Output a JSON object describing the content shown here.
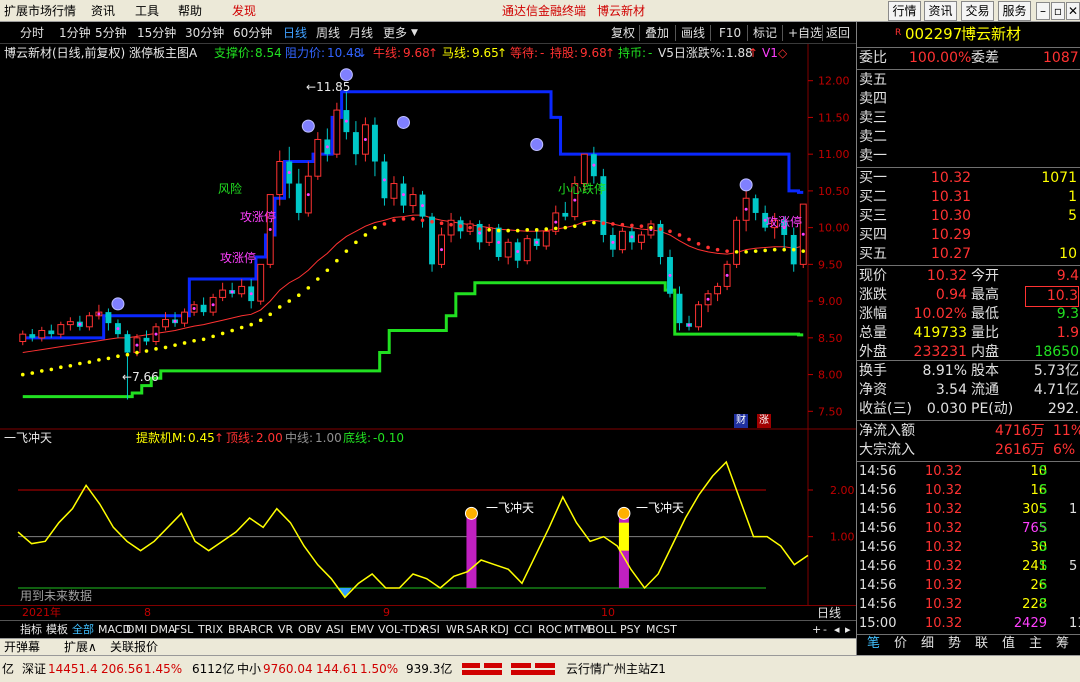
{
  "menu": {
    "items": [
      "扩展市场行情",
      "资讯",
      "工具",
      "帮助"
    ],
    "discover": "发现",
    "center_title": "通达信金融终端",
    "center_stock": "博云新材",
    "right_buttons": [
      "行情",
      "资讯",
      "交易",
      "服务"
    ],
    "win_controls": [
      "–",
      "▫",
      "✕"
    ]
  },
  "periods": {
    "items": [
      "分时",
      "1分钟",
      "5分钟",
      "15分钟",
      "30分钟",
      "60分钟",
      "日线",
      "周线",
      "月线",
      "更多"
    ],
    "active": "日线",
    "more_arrow": "▼",
    "right_items": [
      "复权",
      "叠加",
      "画线",
      "F10",
      "标记",
      "+自选",
      "返回"
    ]
  },
  "info_line": {
    "title": "博云新材(日线,前复权) 涨停板主图A",
    "support_label": "支撑价:",
    "support_value": "8.54",
    "resist_label": "阻力价:",
    "resist_value": "10.48",
    "resist_arrow": "↓",
    "bull_label": "牛线:",
    "bull_value": "9.68",
    "bull_arrow": "↑",
    "horse_label": "马线:",
    "horse_value": "9.65",
    "horse_arrow": "↑",
    "wait_label": "等待:",
    "wait_value": "-",
    "hold_label": "持股:",
    "hold_value": "9.68",
    "hold_arrow": "↑",
    "coin_label": "持币:",
    "coin_value": "-",
    "v5_label": "V5日涨跌%:",
    "v5_value": "1.88",
    "v5_arrow": "↑",
    "v1": "V1",
    "diamond": "◇"
  },
  "main_chart": {
    "y_ticks": [
      "12.00",
      "11.50",
      "11.00",
      "10.50",
      "10.00",
      "9.50",
      "9.00",
      "8.50",
      "8.00",
      "7.50"
    ],
    "high_label": "11.85",
    "low_label": "7.66",
    "annotations": [
      "风险",
      "攻涨停",
      "攻涨停",
      "小心跌停",
      "攻涨停"
    ],
    "badges": [
      "财",
      "涨"
    ]
  },
  "chart_data": {
    "type": "candlestick",
    "y_range": [
      7.3,
      12.2
    ],
    "candles": [
      [
        8.45,
        8.55,
        8.6,
        8.4
      ],
      [
        8.55,
        8.5,
        8.62,
        8.45
      ],
      [
        8.5,
        8.6,
        8.65,
        8.45
      ],
      [
        8.6,
        8.55,
        8.68,
        8.5
      ],
      [
        8.55,
        8.68,
        8.72,
        8.5
      ],
      [
        8.68,
        8.72,
        8.78,
        8.6
      ],
      [
        8.72,
        8.65,
        8.8,
        8.6
      ],
      [
        8.65,
        8.8,
        8.85,
        8.6
      ],
      [
        8.8,
        8.85,
        8.95,
        8.75
      ],
      [
        8.85,
        8.7,
        8.9,
        8.6
      ],
      [
        8.7,
        8.55,
        8.75,
        8.5
      ],
      [
        8.55,
        8.3,
        8.6,
        7.66
      ],
      [
        8.3,
        8.5,
        8.55,
        8.25
      ],
      [
        8.5,
        8.45,
        8.6,
        8.4
      ],
      [
        8.45,
        8.65,
        8.7,
        8.4
      ],
      [
        8.65,
        8.75,
        8.85,
        8.6
      ],
      [
        8.75,
        8.7,
        8.85,
        8.65
      ],
      [
        8.7,
        8.85,
        8.9,
        8.65
      ],
      [
        8.85,
        8.95,
        9.0,
        8.8
      ],
      [
        8.95,
        8.85,
        9.05,
        8.8
      ],
      [
        8.85,
        9.05,
        9.1,
        8.8
      ],
      [
        9.05,
        9.15,
        9.25,
        9.0
      ],
      [
        9.15,
        9.1,
        9.25,
        9.05
      ],
      [
        9.1,
        9.2,
        9.3,
        9.05
      ],
      [
        9.2,
        9.0,
        9.3,
        8.9
      ],
      [
        9.0,
        9.5,
        9.5,
        8.95
      ],
      [
        9.5,
        10.45,
        10.45,
        9.45
      ],
      [
        10.45,
        10.9,
        11.05,
        10.3
      ],
      [
        10.9,
        10.6,
        11.1,
        10.4
      ],
      [
        10.6,
        10.2,
        10.8,
        10.1
      ],
      [
        10.2,
        10.7,
        10.9,
        10.15
      ],
      [
        10.7,
        11.2,
        11.3,
        10.65
      ],
      [
        11.2,
        11.0,
        11.35,
        10.9
      ],
      [
        11.0,
        11.6,
        11.7,
        10.95
      ],
      [
        11.6,
        11.3,
        11.85,
        11.2
      ],
      [
        11.3,
        11.0,
        11.45,
        10.85
      ],
      [
        11.0,
        11.4,
        11.5,
        10.9
      ],
      [
        11.4,
        10.9,
        11.5,
        10.7
      ],
      [
        10.9,
        10.4,
        11.0,
        10.3
      ],
      [
        10.4,
        10.6,
        10.7,
        10.3
      ],
      [
        10.6,
        10.3,
        10.7,
        10.2
      ],
      [
        10.3,
        10.45,
        10.55,
        10.2
      ],
      [
        10.45,
        10.15,
        10.5,
        10.0
      ],
      [
        10.15,
        9.5,
        10.2,
        9.4
      ],
      [
        9.5,
        9.9,
        10.0,
        9.45
      ],
      [
        9.9,
        10.1,
        10.2,
        9.8
      ],
      [
        10.1,
        9.95,
        10.15,
        9.85
      ],
      [
        9.95,
        10.05,
        10.1,
        9.9
      ],
      [
        10.05,
        9.8,
        10.1,
        9.7
      ],
      [
        9.8,
        10.0,
        10.05,
        9.75
      ],
      [
        10.0,
        9.6,
        10.05,
        9.55
      ],
      [
        9.6,
        9.8,
        9.85,
        9.5
      ],
      [
        9.8,
        9.55,
        9.85,
        9.45
      ],
      [
        9.55,
        9.85,
        9.9,
        9.5
      ],
      [
        9.85,
        9.75,
        9.95,
        9.7
      ],
      [
        9.75,
        9.95,
        10.0,
        9.7
      ],
      [
        9.95,
        10.2,
        10.3,
        9.9
      ],
      [
        10.2,
        10.15,
        10.35,
        10.1
      ],
      [
        10.15,
        10.6,
        10.7,
        10.1
      ],
      [
        10.6,
        11.0,
        11.0,
        10.5
      ],
      [
        11.0,
        10.7,
        11.1,
        10.6
      ],
      [
        10.7,
        9.9,
        10.8,
        9.8
      ],
      [
        9.9,
        9.7,
        10.0,
        9.6
      ],
      [
        9.7,
        9.95,
        10.0,
        9.65
      ],
      [
        9.95,
        9.8,
        10.05,
        9.7
      ],
      [
        9.8,
        9.9,
        9.95,
        9.7
      ],
      [
        9.9,
        10.05,
        10.1,
        9.85
      ],
      [
        10.05,
        9.6,
        10.1,
        9.5
      ],
      [
        9.6,
        9.1,
        9.7,
        9.05
      ],
      [
        9.1,
        8.7,
        9.2,
        8.6
      ],
      [
        8.7,
        8.65,
        8.8,
        8.6
      ],
      [
        8.65,
        8.95,
        9.0,
        8.6
      ],
      [
        8.95,
        9.1,
        9.15,
        8.85
      ],
      [
        9.1,
        9.2,
        9.25,
        9.0
      ],
      [
        9.2,
        9.5,
        9.55,
        9.15
      ],
      [
        9.5,
        10.1,
        10.15,
        9.45
      ],
      [
        10.1,
        10.4,
        10.5,
        9.95
      ],
      [
        10.4,
        10.2,
        10.45,
        10.1
      ],
      [
        10.2,
        10.0,
        10.3,
        9.95
      ],
      [
        10.0,
        10.1,
        10.2,
        9.85
      ],
      [
        10.1,
        9.9,
        10.15,
        9.7
      ],
      [
        9.9,
        9.5,
        10.0,
        9.4
      ],
      [
        9.5,
        10.32,
        10.32,
        9.45
      ]
    ],
    "ma_red": [
      8.3,
      8.32,
      8.34,
      8.36,
      8.38,
      8.4,
      8.42,
      8.44,
      8.46,
      8.48,
      8.5,
      8.5,
      8.52,
      8.54,
      8.56,
      8.58,
      8.6,
      8.63,
      8.66,
      8.68,
      8.71,
      8.74,
      8.77,
      8.8,
      8.82,
      8.88,
      9.0,
      9.15,
      9.25,
      9.32,
      9.42,
      9.55,
      9.65,
      9.78,
      9.88,
      9.95,
      10.02,
      10.07,
      10.1,
      10.14,
      10.15,
      10.17,
      10.17,
      10.13,
      10.1,
      10.08,
      10.06,
      10.04,
      10.02,
      10.0,
      9.98,
      9.97,
      9.96,
      9.95,
      9.95,
      9.96,
      9.98,
      10.0,
      10.03,
      10.08,
      10.1,
      10.08,
      10.05,
      10.02,
      10.0,
      9.98,
      9.97,
      9.95,
      9.9,
      9.82,
      9.75,
      9.7,
      9.67,
      9.65,
      9.64,
      9.66,
      9.7,
      9.72,
      9.73,
      9.74,
      9.74,
      9.72,
      9.75
    ],
    "ma_yellow_dots": [
      8.0,
      8.02,
      8.05,
      8.07,
      8.1,
      8.12,
      8.15,
      8.17,
      8.2,
      8.22,
      8.25,
      8.27,
      8.3,
      8.32,
      8.35,
      8.37,
      8.4,
      8.43,
      8.46,
      8.48,
      8.52,
      8.56,
      8.6,
      8.64,
      8.68,
      8.74,
      8.82,
      8.92,
      9.0,
      9.08,
      9.18,
      9.3,
      9.42,
      9.55,
      9.68,
      9.8,
      9.9,
      10.0,
      10.05,
      10.1,
      10.12,
      10.12,
      10.1,
      10.08,
      10.06,
      10.04,
      10.02,
      10.0,
      9.98,
      9.97,
      9.96,
      9.96,
      9.96,
      9.97,
      9.97,
      9.98,
      9.99,
      10.0,
      10.02,
      10.05,
      10.07,
      10.06,
      10.05,
      10.04,
      10.03,
      10.02,
      10.0,
      9.98,
      9.95,
      9.9,
      9.84,
      9.78,
      9.73,
      9.7,
      9.68,
      9.67,
      9.67,
      9.68,
      9.69,
      9.7,
      9.7,
      9.7,
      9.68
    ],
    "resist_blue": [
      8.5,
      8.5,
      8.5,
      8.5,
      8.5,
      8.5,
      8.5,
      8.5,
      8.5,
      8.8,
      8.8,
      8.8,
      8.8,
      8.8,
      8.8,
      8.8,
      8.8,
      8.8,
      9.3,
      9.3,
      9.3,
      9.3,
      9.3,
      9.3,
      9.3,
      9.6,
      9.9,
      10.4,
      10.9,
      10.9,
      10.9,
      11.0,
      11.0,
      11.5,
      11.85,
      11.85,
      11.85,
      11.85,
      11.85,
      11.85,
      11.85,
      11.85,
      11.85,
      11.85,
      11.85,
      11.85,
      11.85,
      11.85,
      11.85,
      11.85,
      11.85,
      11.85,
      11.85,
      11.85,
      11.85,
      11.85,
      11.5,
      11.0,
      11.0,
      11.0,
      11.0,
      11.0,
      11.0,
      11.0,
      11.0,
      11.0,
      11.0,
      11.0,
      11.0,
      11.0,
      11.0,
      11.0,
      11.0,
      11.0,
      11.0,
      11.0,
      11.0,
      11.0,
      11.0,
      11.0,
      11.0,
      10.5,
      10.48
    ],
    "support_green": [
      7.7,
      7.7,
      7.7,
      7.7,
      7.7,
      7.7,
      7.7,
      7.7,
      7.7,
      7.7,
      7.7,
      7.7,
      7.75,
      7.85,
      7.95,
      8.05,
      8.05,
      8.05,
      8.05,
      8.05,
      8.05,
      8.05,
      8.05,
      8.05,
      8.05,
      8.05,
      8.05,
      8.05,
      8.05,
      8.05,
      8.05,
      8.05,
      8.05,
      8.05,
      8.05,
      8.05,
      8.05,
      8.05,
      8.3,
      8.6,
      8.6,
      8.6,
      8.6,
      8.6,
      8.6,
      8.8,
      9.1,
      9.1,
      9.25,
      9.25,
      9.25,
      9.25,
      9.25,
      9.25,
      9.25,
      9.25,
      9.25,
      9.25,
      9.25,
      9.25,
      9.25,
      9.25,
      9.25,
      9.25,
      9.25,
      9.25,
      9.25,
      9.25,
      9.15,
      8.55,
      8.55,
      8.55,
      8.55,
      8.55,
      8.55,
      8.55,
      8.55,
      8.55,
      8.55,
      8.55,
      8.55,
      8.55,
      8.54
    ],
    "indicator": {
      "name": "一飞冲天",
      "label": "提款机M:",
      "value": "0.45",
      "arrow": "↑",
      "top_label": "顶线:",
      "top_value": "2.00",
      "mid_label": "中线:",
      "mid_value": "1.00",
      "bot_label": "底线:",
      "bot_value": "-0.10",
      "y_ticks": [
        "2.00",
        "1.00"
      ],
      "annotation": "一飞冲天",
      "note": "用到未来数据",
      "series": [
        1.1,
        0.85,
        0.9,
        1.3,
        1.6,
        2.1,
        1.7,
        1.2,
        0.9,
        0.7,
        0.9,
        1.2,
        1.5,
        0.9,
        0.7,
        0.9,
        1.1,
        1.4,
        1.2,
        1.6,
        1.3,
        0.8,
        0.4,
        0.1,
        -0.3,
        0.0,
        0.2,
        -0.1,
        -0.1,
        0.2,
        0.1,
        -0.1,
        0.15,
        0.25,
        0.5,
        0.4,
        0.3,
        0.0,
        0.6,
        1.2,
        1.85,
        1.3,
        0.9,
        1.0,
        0.8,
        0.3,
        -0.1,
        0.2,
        0.8,
        1.4,
        1.9,
        2.3,
        2.6,
        1.8,
        1.0,
        1.0,
        0.8,
        0.4,
        0.6
      ],
      "ylim": [
        -0.4,
        2.9
      ]
    }
  },
  "time_axis": {
    "labels": [
      "2021年",
      "8",
      "9",
      "10"
    ]
  },
  "ind_tabs": {
    "items": [
      "指标",
      "模板",
      "全部",
      "MACD",
      "DMI",
      "DMA",
      "FSL",
      "TRIX",
      "BRAR",
      "CR",
      "VR",
      "OBV",
      "ASI",
      "EMV",
      "VOL-TDX",
      "RSI",
      "WR",
      "SAR",
      "KDJ",
      "CCI",
      "ROC",
      "MTM",
      "BOLL",
      "PSY",
      "MCST"
    ],
    "active": "全部",
    "right": [
      "+",
      "-",
      "◂",
      "▸"
    ]
  },
  "bottom_tabs": {
    "items": [
      "开弹幕",
      "扩展∧",
      "关联报价"
    ]
  },
  "status_bar": {
    "lead": "亿",
    "sz_label": "深证",
    "sz_value": "14451.4",
    "sz_change": "206.56",
    "sz_pct": "1.45%",
    "sz_amount": "6112亿",
    "zx_label": "中小",
    "zx_value": "9760.04",
    "zx_change": "144.61",
    "zx_pct": "1.50%",
    "zx_amount": "939.3亿",
    "server": "云行情广州主站Z1"
  },
  "quote_panel": {
    "r_mark": "R",
    "code": "002297",
    "name": "博云新材",
    "webi_label": "委比",
    "webi_value": "100.00%",
    "weicha_label": "委差",
    "weicha_value": "1087",
    "sells": [
      {
        "label": "卖五",
        "price": "",
        "vol": ""
      },
      {
        "label": "卖四",
        "price": "",
        "vol": ""
      },
      {
        "label": "卖三",
        "price": "",
        "vol": ""
      },
      {
        "label": "卖二",
        "price": "",
        "vol": ""
      },
      {
        "label": "卖一",
        "price": "",
        "vol": ""
      }
    ],
    "buys": [
      {
        "label": "买一",
        "price": "10.32",
        "vol": "1071"
      },
      {
        "label": "买二",
        "price": "10.31",
        "vol": "1"
      },
      {
        "label": "买三",
        "price": "10.30",
        "vol": "5"
      },
      {
        "label": "买四",
        "price": "10.29",
        "vol": ""
      },
      {
        "label": "买五",
        "price": "10.27",
        "vol": "10"
      }
    ],
    "stats": [
      {
        "l1": "现价",
        "v1": "10.32",
        "l2": "今开",
        "v2": "9.4"
      },
      {
        "l1": "涨跌",
        "v1": "0.94",
        "l2": "最高",
        "v2": "10.3"
      },
      {
        "l1": "涨幅",
        "v1": "10.02%",
        "l2": "最低",
        "v2": "9.3"
      },
      {
        "l1": "总量",
        "v1": "419733",
        "l2": "量比",
        "v2": "1.9"
      },
      {
        "l1": "外盘",
        "v1": "233231",
        "l2": "内盘",
        "v2": "18650"
      }
    ],
    "fundamentals": [
      {
        "l1": "换手",
        "v1": "8.91%",
        "l2": "股本",
        "v2": "5.73亿"
      },
      {
        "l1": "净资",
        "v1": "3.54",
        "l2": "流通",
        "v2": "4.71亿"
      },
      {
        "l1": "收益(三)",
        "v1": "0.030",
        "l2": "PE(动)",
        "v2": "292."
      }
    ],
    "flows": [
      {
        "label": "净流入额",
        "value": "4716万",
        "extra": "11%"
      },
      {
        "label": "大宗流入",
        "value": "2616万",
        "extra": "6%"
      }
    ],
    "ticks": [
      {
        "time": "14:56",
        "price": "10.32",
        "vol": "10",
        "side": "S",
        "n": ""
      },
      {
        "time": "14:56",
        "price": "10.32",
        "vol": "16",
        "side": "S",
        "n": ""
      },
      {
        "time": "14:56",
        "price": "10.32",
        "vol": "305",
        "side": "S",
        "n": "1"
      },
      {
        "time": "14:56",
        "price": "10.32",
        "vol": "765",
        "side": "S",
        "n": ""
      },
      {
        "time": "14:56",
        "price": "10.32",
        "vol": "30",
        "side": "S",
        "n": ""
      },
      {
        "time": "14:56",
        "price": "10.32",
        "vol": "241",
        "side": "S",
        "n": "5"
      },
      {
        "time": "14:56",
        "price": "10.32",
        "vol": "26",
        "side": "S",
        "n": ""
      },
      {
        "time": "14:56",
        "price": "10.32",
        "vol": "228",
        "side": "S",
        "n": ""
      },
      {
        "time": "15:00",
        "price": "10.32",
        "vol": "2429",
        "side": "",
        "n": "11"
      }
    ],
    "bottom_tabs": [
      "笔",
      "价",
      "细",
      "势",
      "联",
      "值",
      "主",
      "筹"
    ]
  },
  "colors": {
    "up": "#ff3232",
    "down": "#00c8c8",
    "blue": "#0a28ff",
    "green": "#21e021",
    "yellow": "#ffff00",
    "magenta": "#ff40ff"
  }
}
